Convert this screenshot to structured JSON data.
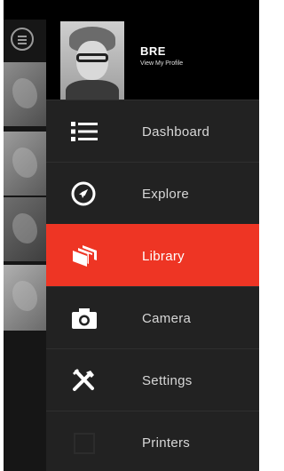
{
  "user": {
    "name": "BRE",
    "profile_link": "View My Profile"
  },
  "menu": {
    "items": [
      {
        "label": "Dashboard",
        "icon": "list-icon"
      },
      {
        "label": "Explore",
        "icon": "compass-icon"
      },
      {
        "label": "Library",
        "icon": "stack-icon",
        "active": true
      },
      {
        "label": "Camera",
        "icon": "camera-icon"
      },
      {
        "label": "Settings",
        "icon": "tools-icon"
      },
      {
        "label": "Printers",
        "icon": "printer-icon"
      }
    ]
  },
  "colors": {
    "accent": "#ee3524",
    "menu_bg": "#222222",
    "header_bg": "#000000"
  }
}
